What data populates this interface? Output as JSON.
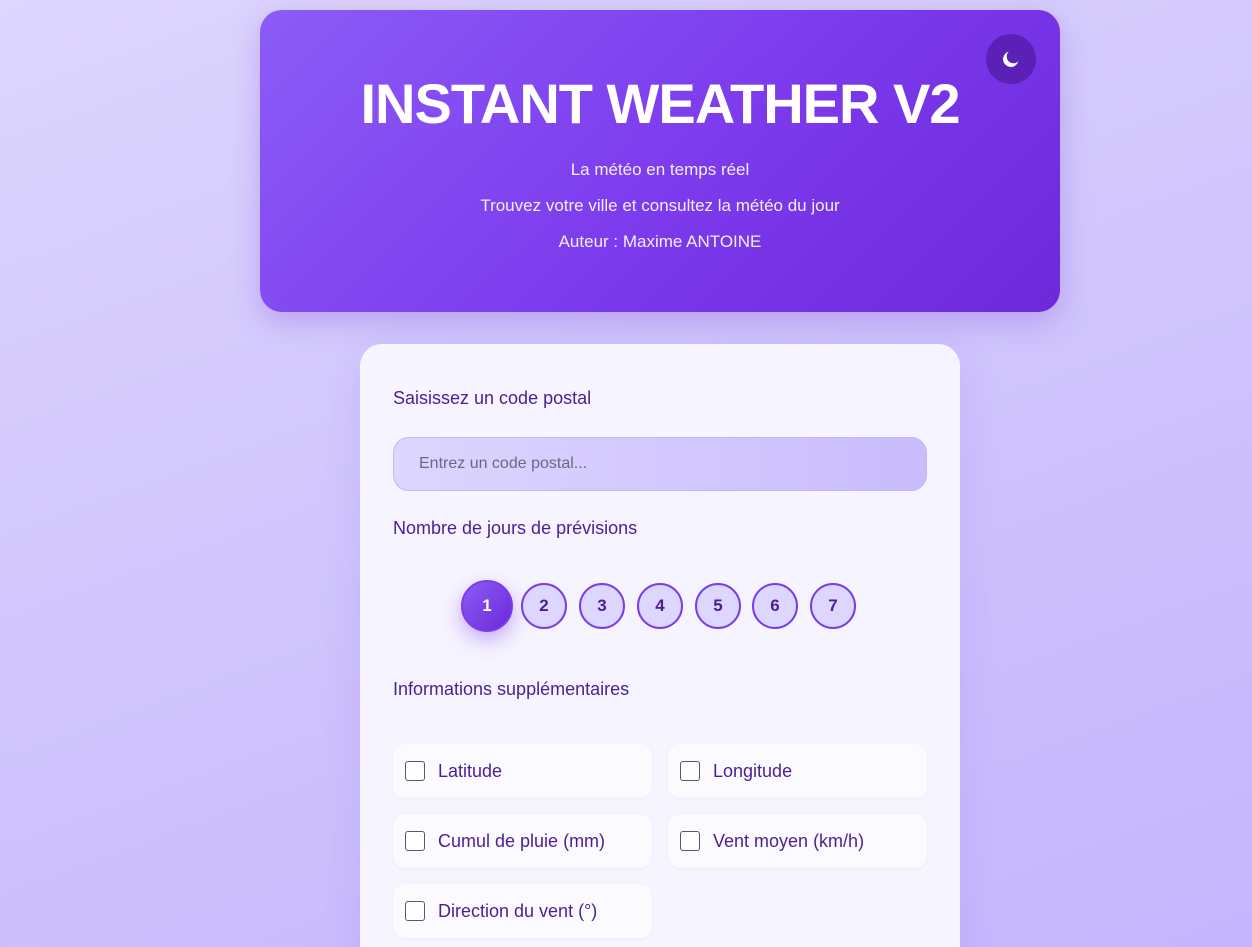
{
  "header": {
    "title": "INSTANT WEATHER V2",
    "subtitle": "La météo en temps réel",
    "tagline": "Trouvez votre ville et consultez la météo du jour",
    "author": "Auteur : Maxime ANTOINE",
    "theme_toggle_icon": "moon-icon"
  },
  "form": {
    "postal_label": "Saisissez un code postal",
    "postal_placeholder": "Entrez un code postal...",
    "postal_value": "",
    "days_label": "Nombre de jours de prévisions",
    "days": [
      "1",
      "2",
      "3",
      "4",
      "5",
      "6",
      "7"
    ],
    "selected_day": "1",
    "extra_label": "Informations supplémentaires",
    "options": [
      {
        "label": "Latitude",
        "checked": false
      },
      {
        "label": "Longitude",
        "checked": false
      },
      {
        "label": "Cumul de pluie (mm)",
        "checked": false
      },
      {
        "label": "Vent moyen (km/h)",
        "checked": false
      },
      {
        "label": "Direction du vent (°)",
        "checked": false
      }
    ]
  },
  "colors": {
    "accent": "#7c3aed",
    "text": "#4c1d95",
    "background": "#ddd6fe"
  }
}
